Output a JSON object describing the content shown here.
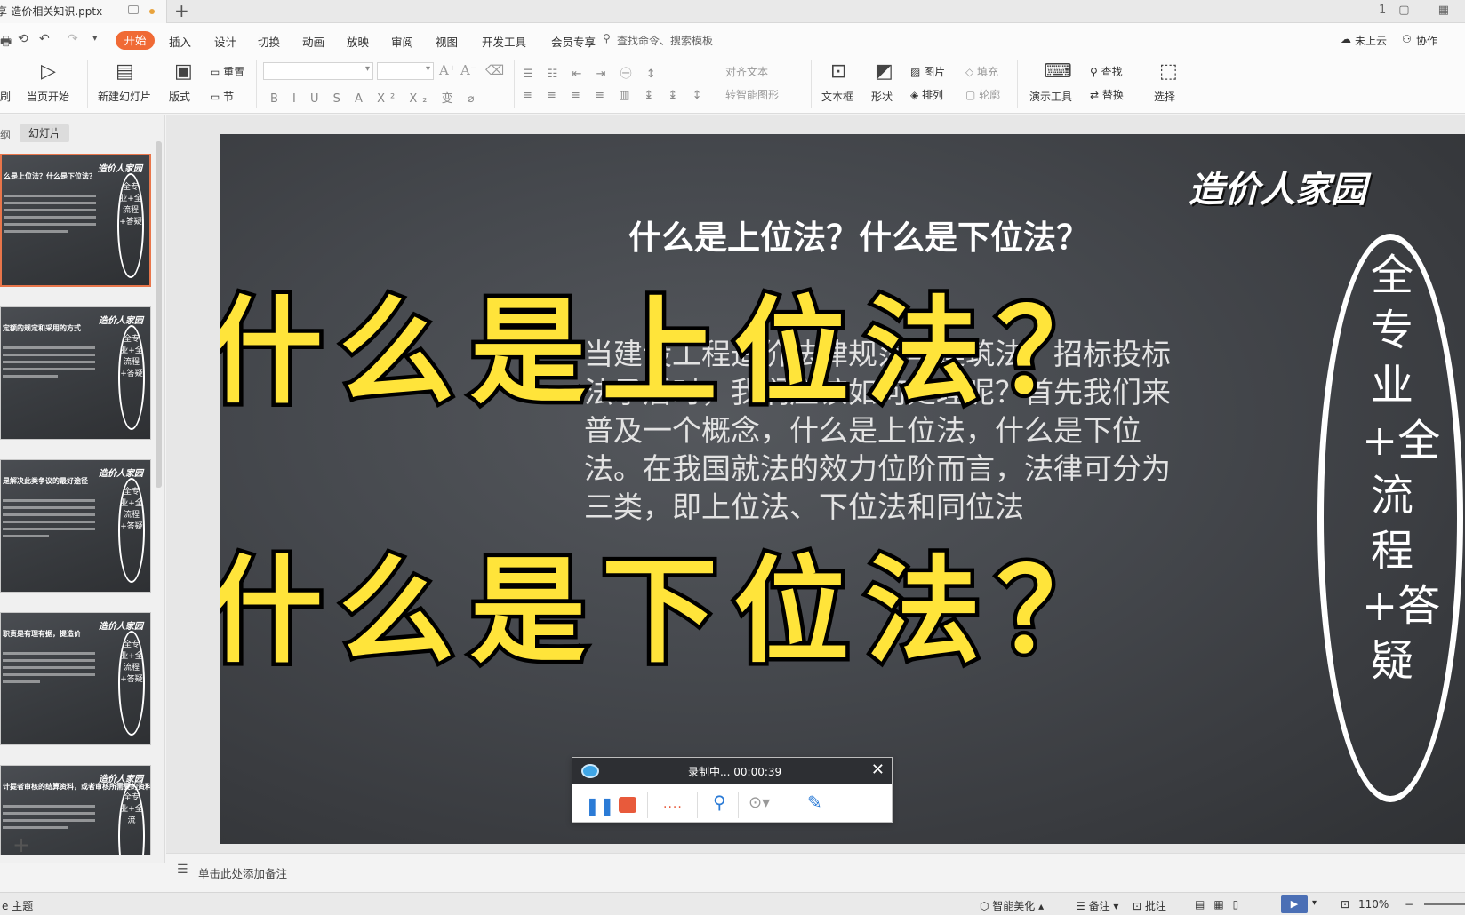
{
  "window": {
    "doc_tab_title": "享-造价相关知识.pptx",
    "new_tab": "+",
    "win_icons": "1▢ ▦"
  },
  "menu": {
    "quick_icons": [
      "🖶",
      "⟲",
      "↶",
      "↷",
      "▾"
    ],
    "start": "开始",
    "items": [
      "插入",
      "设计",
      "切换",
      "动画",
      "放映",
      "审阅",
      "视图",
      "开发工具",
      "会员专享"
    ],
    "search_placeholder": "查找命令、搜索模板",
    "cloud": "未上云",
    "collab": "协作"
  },
  "ribbon": {
    "play_from_current": "当页开始",
    "new_slide": "新建幻灯片",
    "layout": "版式",
    "reset": "重置",
    "section": "节",
    "align_text": "对齐文本",
    "convert_smartart": "转智能图形",
    "textbox": "文本框",
    "shape": "形状",
    "picture": "图片",
    "arrange": "排列",
    "fill": "填充",
    "outline": "轮廓",
    "presentation_tools": "演示工具",
    "find": "查找",
    "replace": "替换",
    "select": "选择",
    "left_cut": "刷"
  },
  "left_pane": {
    "tab_outline": "纲",
    "tab_slides": "幻灯片",
    "thumbnails": [
      {
        "logo": "造价人家园",
        "title": "么是上位法？什么是下位法？",
        "oval": "全专业+全流程+答疑",
        "active": true
      },
      {
        "logo": "造价人家园",
        "title": "定额的规定和采用的方式",
        "oval": "全专业+全流程+答疑",
        "active": false
      },
      {
        "logo": "造价人家园",
        "title": "是解决此类争议的最好途径",
        "oval": "全专业+全流程+答疑",
        "active": false
      },
      {
        "logo": "造价人家园",
        "title": "职责是有理有据，提造价",
        "oval": "全专业+全流程+答疑",
        "active": false
      },
      {
        "logo": "造价人家园",
        "title": "计提者审核的结算资料，或者审核所需要的资料有哪些？",
        "oval": "全专业+全流",
        "active": false
      }
    ],
    "add_slide": "+"
  },
  "slide": {
    "logo": "造价人家园",
    "vertical_text": "全专业+全流程+答疑",
    "title": "什么是上位法？什么是下位法？",
    "body": "当建设工程造价法律规范与建筑法、招标投标法矛盾时，我们应该如何处理呢？首先我们来普及一个概念，什么是上位法，什么是下位法。在我国就法的效力位阶而言，法律可分为三类，即上位法、下位法和同位法",
    "overlay_line1": "什么是上位法？",
    "overlay_line2": "什么是下位法？"
  },
  "recorder": {
    "status": "录制中... 00:00:39",
    "close": "✕",
    "pause": "❚❚",
    "wave": "....",
    "tool_icon": "⚲",
    "webcam_icon": "⊙▾",
    "pen_icon": "✎"
  },
  "notes": {
    "placeholder": "单击此处添加备注"
  },
  "status": {
    "theme": "e 主题",
    "beautify": "智能美化",
    "notes": "备注",
    "comments": "批注",
    "zoom": "110%"
  }
}
